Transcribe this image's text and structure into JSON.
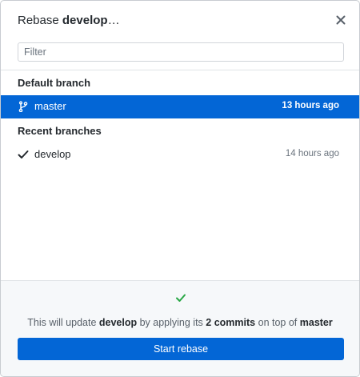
{
  "dialog": {
    "title_prefix": "Rebase ",
    "title_branch": "develop",
    "title_suffix": "…"
  },
  "filter": {
    "placeholder": "Filter",
    "value": ""
  },
  "groups": {
    "default": {
      "header": "Default branch",
      "branch": {
        "name": "master",
        "time": "13 hours ago",
        "icon": "git-branch-icon",
        "selected": true
      }
    },
    "recent": {
      "header": "Recent branches",
      "branch": {
        "name": "develop",
        "time": "14 hours ago",
        "icon": "check-icon",
        "selected": false
      }
    }
  },
  "footer": {
    "status_icon": "check-icon",
    "status_color": "#28a745",
    "summary": {
      "part1": "This will update ",
      "current_branch": "develop",
      "part2": " by applying its ",
      "commit_count": "2 commits",
      "part3": " on top of ",
      "base_branch": "master"
    },
    "button_label": "Start rebase"
  },
  "colors": {
    "accent": "#0366d6",
    "success": "#28a745",
    "muted_text": "#6a737d",
    "border": "#e1e4e8"
  }
}
